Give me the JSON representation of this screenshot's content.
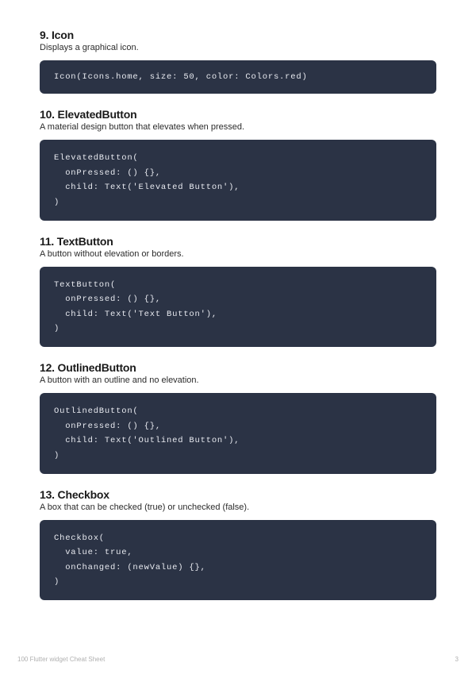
{
  "sections": [
    {
      "heading": "9. Icon",
      "desc": "Displays a graphical icon.",
      "code": "Icon(Icons.home, size: 50, color: Colors.red)",
      "single": true
    },
    {
      "heading": "10. ElevatedButton",
      "desc": "A material design button that elevates when pressed.",
      "code": "ElevatedButton(\n  onPressed: () {},\n  child: Text('Elevated Button'),\n)",
      "single": false
    },
    {
      "heading": "11. TextButton",
      "desc": "A button without elevation or borders.",
      "code": "TextButton(\n  onPressed: () {},\n  child: Text('Text Button'),\n)",
      "single": false
    },
    {
      "heading": "12. OutlinedButton",
      "desc": "A button with an outline and no elevation.",
      "code": "OutlinedButton(\n  onPressed: () {},\n  child: Text('Outlined Button'),\n)",
      "single": false
    },
    {
      "heading": "13. Checkbox",
      "desc": "A box that can be checked (true) or unchecked (false).",
      "code": "Checkbox(\n  value: true,\n  onChanged: (newValue) {},\n)",
      "single": false
    }
  ],
  "footer": {
    "left": "100 Flutter widget Cheat Sheet",
    "right": "3"
  }
}
